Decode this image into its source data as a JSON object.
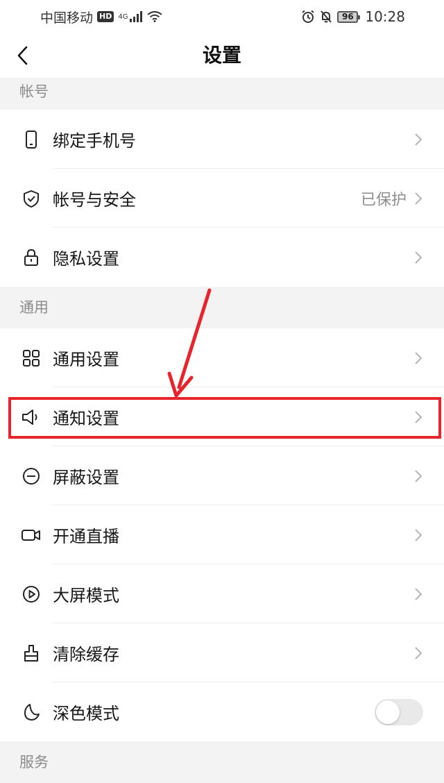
{
  "status_bar": {
    "carrier": "中国移动",
    "hd_badge": "HD",
    "network": "4G",
    "battery": "96",
    "time": "10:28",
    "icons": [
      "signal-icon",
      "wifi-icon",
      "alarm-icon",
      "bell-muted-icon",
      "battery-icon"
    ]
  },
  "header": {
    "title": "设置",
    "back_icon": "back-arrow-icon"
  },
  "sections": [
    {
      "title": "帐号",
      "items": [
        {
          "label": "绑定手机号",
          "icon": "phone-icon",
          "value": ""
        },
        {
          "label": "帐号与安全",
          "icon": "shield-icon",
          "value": "已保护"
        },
        {
          "label": "隐私设置",
          "icon": "lock-icon",
          "value": ""
        }
      ]
    },
    {
      "title": "通用",
      "items": [
        {
          "label": "通用设置",
          "icon": "grid-icon",
          "value": ""
        },
        {
          "label": "通知设置",
          "icon": "speaker-icon",
          "value": ""
        },
        {
          "label": "屏蔽设置",
          "icon": "block-icon",
          "value": ""
        },
        {
          "label": "开通直播",
          "icon": "video-camera-icon",
          "value": ""
        },
        {
          "label": "大屏模式",
          "icon": "play-icon",
          "value": ""
        },
        {
          "label": "清除缓存",
          "icon": "brush-icon",
          "value": ""
        },
        {
          "label": "深色模式",
          "icon": "moon-icon",
          "toggle": false
        }
      ]
    },
    {
      "title": "服务",
      "items": []
    }
  ],
  "annotation": {
    "color": "#e8242c",
    "highlighted_item": "通知设置"
  }
}
